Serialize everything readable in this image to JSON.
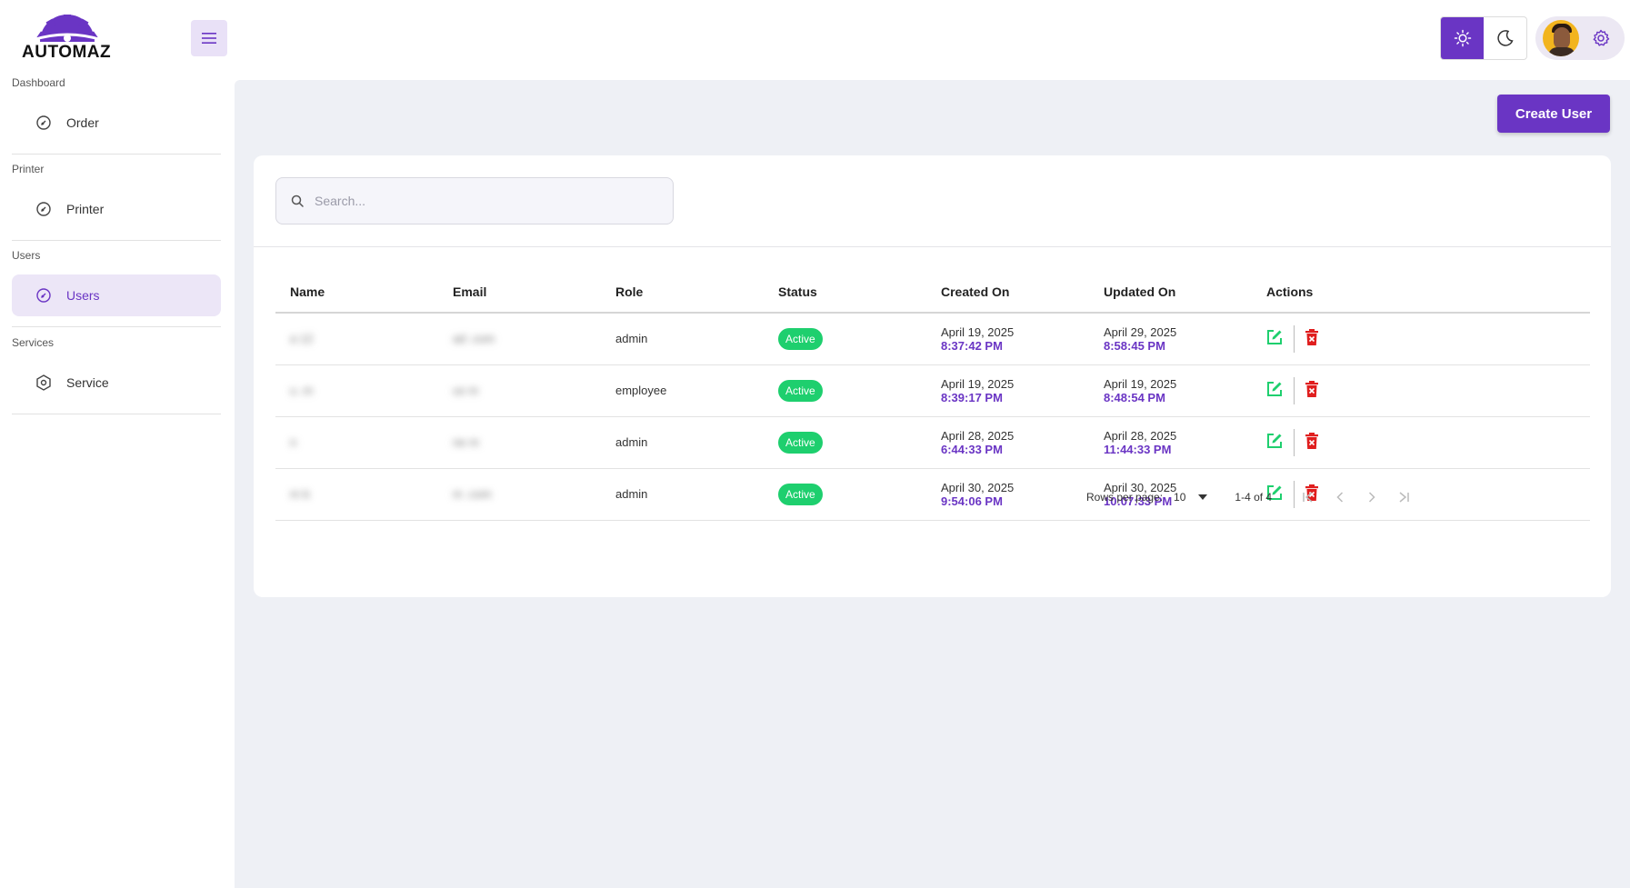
{
  "brand": {
    "name": "AUTOMAZ",
    "color": "#6a35c4"
  },
  "sidebar": {
    "sections": [
      {
        "label": "Dashboard",
        "item": "Order",
        "icon": "gauge-icon"
      },
      {
        "label": "Printer",
        "item": "Printer",
        "icon": "gauge-icon"
      },
      {
        "label": "Users",
        "item": "Users",
        "icon": "gauge-icon",
        "active": true
      },
      {
        "label": "Services",
        "item": "Service",
        "icon": "hexagon-icon"
      }
    ]
  },
  "header": {
    "theme": "light"
  },
  "toolbar": {
    "create_label": "Create User"
  },
  "search": {
    "placeholder": "Search..."
  },
  "table": {
    "columns": [
      "Name",
      "Email",
      "Role",
      "Status",
      "Created On",
      "Updated On",
      "Actions"
    ],
    "rows": [
      {
        "name": "a   12",
        "email": "ad           .com",
        "role": "admin",
        "status": "Active",
        "created_date": "April 19, 2025",
        "created_time": "8:37:42 PM",
        "updated_date": "April 29, 2025",
        "updated_time": "8:58:45 PM"
      },
      {
        "name": "u        .m",
        "email": "us           m",
        "role": "employee",
        "status": "Active",
        "created_date": "April 19, 2025",
        "created_time": "8:39:17 PM",
        "updated_date": "April 19, 2025",
        "updated_time": "8:48:54 PM"
      },
      {
        "name": "n  ",
        "email": "ne        m",
        "role": "admin",
        "status": "Active",
        "created_date": "April 28, 2025",
        "created_time": "6:44:33 PM",
        "updated_date": "April 28, 2025",
        "updated_time": "11:44:33 PM"
      },
      {
        "name": "m   b",
        "email": "m           .com",
        "role": "admin",
        "status": "Active",
        "created_date": "April 30, 2025",
        "created_time": "9:54:06 PM",
        "updated_date": "April 30, 2025",
        "updated_time": "10:07:33 PM"
      }
    ]
  },
  "pagination": {
    "rows_per_page_label": "Rows per page:",
    "rows_per_page": "10",
    "range": "1-4 of 4"
  },
  "colors": {
    "accent": "#6a35c4",
    "active_badge": "#1ecf6e",
    "edit": "#1ecf6e",
    "delete": "#e01e1e"
  }
}
